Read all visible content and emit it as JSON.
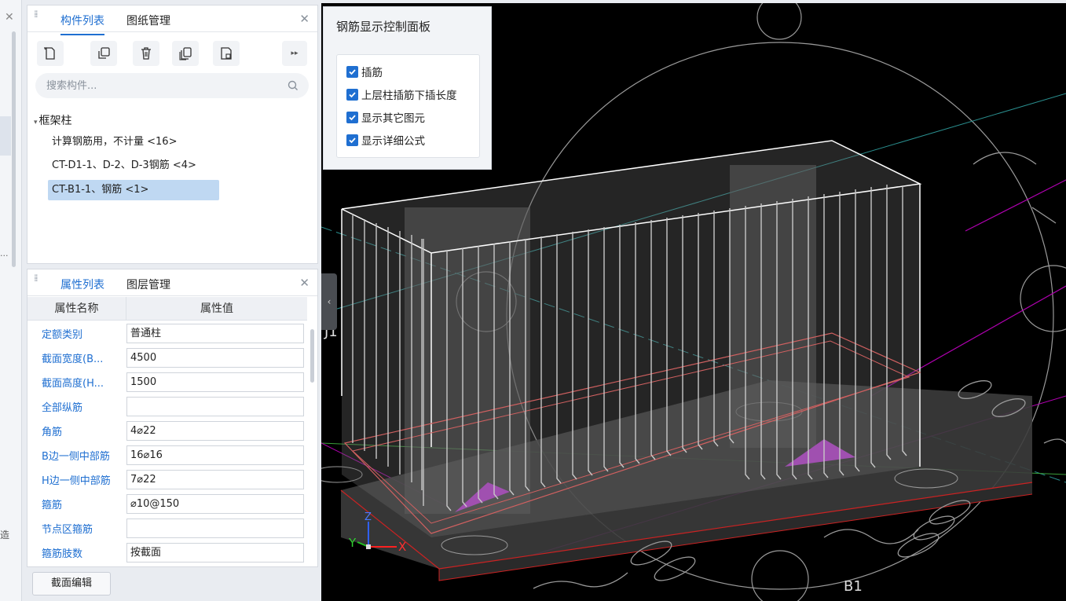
{
  "component_panel": {
    "tabs": [
      "构件列表",
      "图纸管理"
    ],
    "search_placeholder": "搜索构件...",
    "tree": {
      "root": "框架柱",
      "items": [
        {
          "label": "计算钢筋用，不计量 <16>",
          "selected": false
        },
        {
          "label": "CT-D1-1、D-2、D-3钢筋 <4>",
          "selected": false
        },
        {
          "label": "CT-B1-1、钢筋 <1>",
          "selected": true
        }
      ]
    },
    "toolbar_icons": [
      "new-icon",
      "copy-icon",
      "delete-icon",
      "duplicate-icon",
      "save-as-icon",
      "more-icon"
    ]
  },
  "property_panel": {
    "tabs": [
      "属性列表",
      "图层管理"
    ],
    "headers": [
      "属性名称",
      "属性值"
    ],
    "rows": [
      {
        "name": "定额类别",
        "value": "普通柱"
      },
      {
        "name": "截面宽度(B...",
        "value": "4500"
      },
      {
        "name": "截面高度(H...",
        "value": "1500"
      },
      {
        "name": "全部纵筋",
        "value": ""
      },
      {
        "name": "角筋",
        "value": "4⌀22"
      },
      {
        "name": "B边一侧中部筋",
        "value": "16⌀16"
      },
      {
        "name": "H边一侧中部筋",
        "value": "7⌀22"
      },
      {
        "name": "箍筋",
        "value": "⌀10@150"
      },
      {
        "name": "节点区箍筋",
        "value": ""
      },
      {
        "name": "箍筋肢数",
        "value": "按截面"
      }
    ],
    "edit_button": "截面编辑"
  },
  "rebar_panel": {
    "title": "钢筋显示控制面板",
    "options": [
      {
        "label": "插筋",
        "checked": true
      },
      {
        "label": "上层柱插筋下插长度",
        "checked": true
      },
      {
        "label": "显示其它图元",
        "checked": true
      },
      {
        "label": "显示详细公式",
        "checked": true
      }
    ]
  },
  "viewport": {
    "axis_labels": {
      "x": "X",
      "y": "Y",
      "z": "Z"
    },
    "grid_label_left": "J1",
    "grid_label_bottom": "B1"
  }
}
